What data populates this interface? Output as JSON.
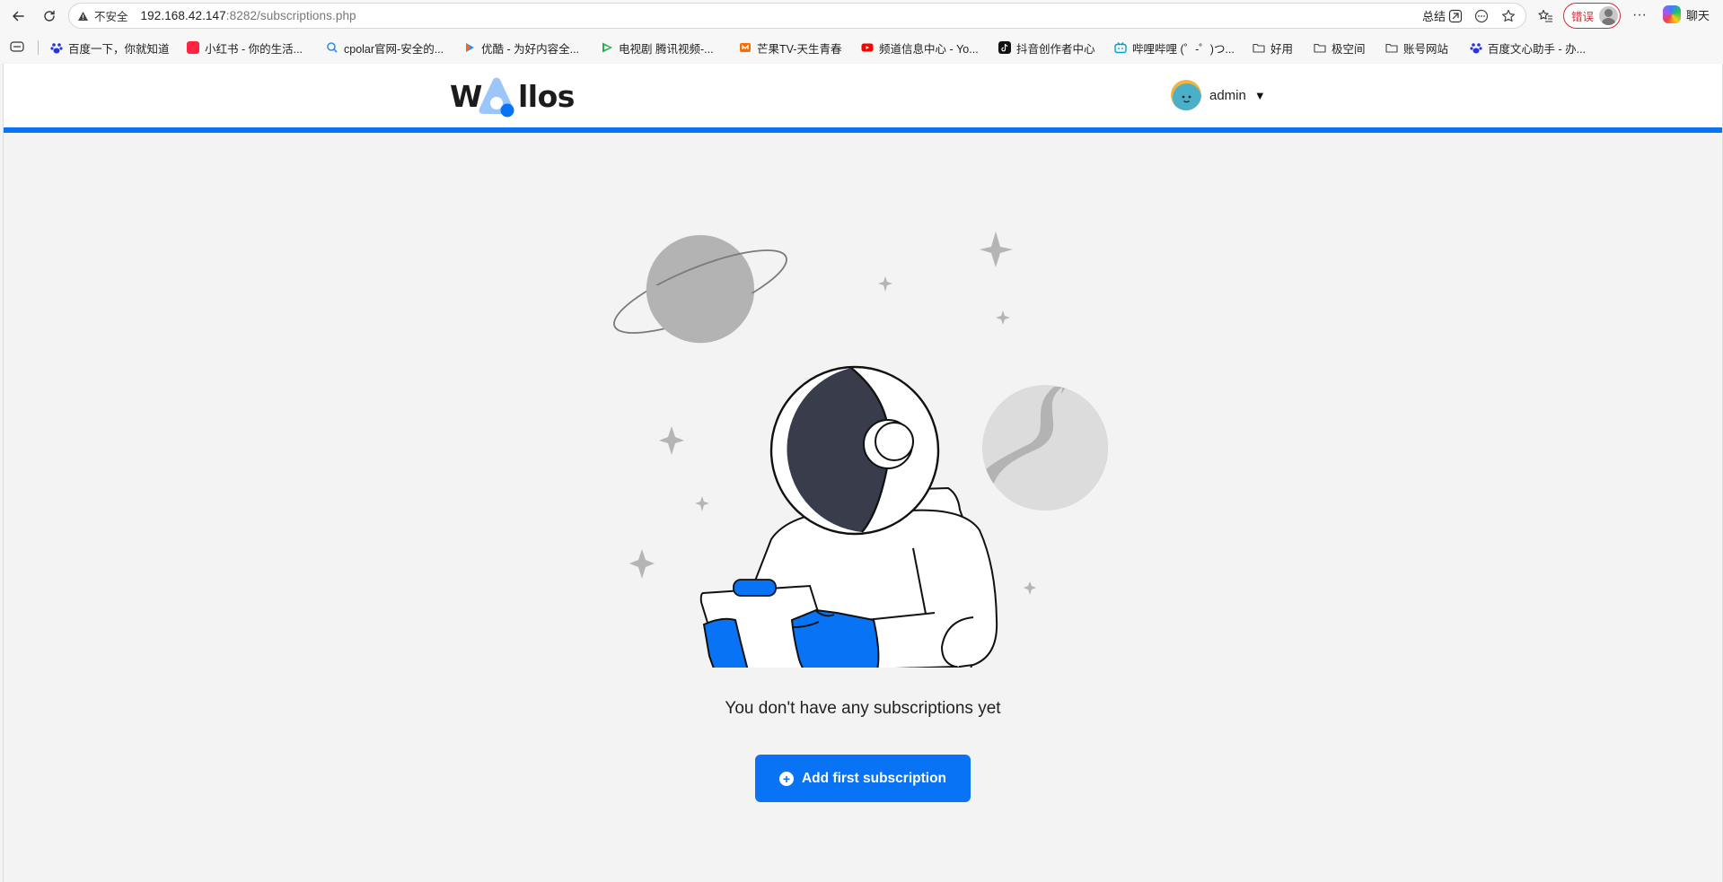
{
  "browser": {
    "security_label": "不安全",
    "url_host": "192.168.42.147",
    "url_rest": ":8282/subscriptions.php",
    "summary_label": "总结",
    "error_label": "错误",
    "more_label": "···",
    "chat_label": "聊天"
  },
  "bookmarks": [
    {
      "label": "百度一下，你就知道",
      "icon": "baidu-icon",
      "color": "#2932e1"
    },
    {
      "label": "小红书 - 你的生活...",
      "icon": "xiaohongshu-icon",
      "color": "#ff2442"
    },
    {
      "label": "cpolar官网-安全的...",
      "icon": "cpolar-icon",
      "color": "#2d8cf0"
    },
    {
      "label": "优酷 - 为好内容全...",
      "icon": "youku-icon",
      "color": "#1f8fff"
    },
    {
      "label": "电视剧 腾讯视频-...",
      "icon": "tencent-video-icon",
      "color": "#20b04b"
    },
    {
      "label": "芒果TV-天生青春",
      "icon": "mangotv-icon",
      "color": "#ff6a00"
    },
    {
      "label": "频道信息中心 - Yo...",
      "icon": "youtube-icon",
      "color": "#ff0000"
    },
    {
      "label": "抖音创作者中心",
      "icon": "douyin-icon",
      "color": "#111111"
    },
    {
      "label": "哔哩哔哩 (゜-゜)つ...",
      "icon": "bilibili-icon",
      "color": "#00a1d6"
    },
    {
      "label": "好用",
      "icon": "folder-icon",
      "color": "#555555"
    },
    {
      "label": "极空间",
      "icon": "folder-icon",
      "color": "#555555"
    },
    {
      "label": "账号网站",
      "icon": "folder-icon",
      "color": "#555555"
    },
    {
      "label": "百度文心助手 - 办...",
      "icon": "baidu-icon",
      "color": "#2932e1"
    }
  ],
  "app": {
    "brand_w": "W",
    "brand_rest": "llos",
    "user_name": "admin",
    "user_caret": "▼",
    "empty_message": "You don't have any subscriptions yet",
    "add_button_label": "Add first subscription",
    "accent_color": "#0873f4"
  }
}
